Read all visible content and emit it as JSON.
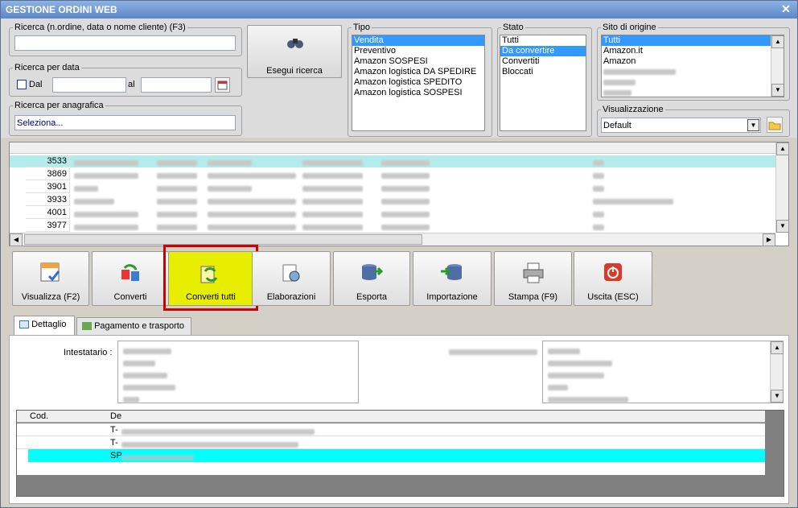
{
  "window": {
    "title": "GESTIONE ORDINI WEB"
  },
  "search": {
    "legend": "Ricerca (n.ordine, data o nome cliente) (F3)",
    "value": ""
  },
  "search_date": {
    "legend": "Ricerca per data",
    "dal_label": "Dal",
    "al_label": "al"
  },
  "search_registry": {
    "legend": "Ricerca per anagrafica",
    "value": "Seleziona..."
  },
  "run_search_button": {
    "label": "Esegui ricerca"
  },
  "tipo": {
    "legend": "Tipo",
    "items": [
      "Vendita",
      "Preventivo",
      "Amazon SOSPESI",
      "Amazon logistica DA SPEDIRE",
      "Amazon logistica SPEDITO",
      "Amazon logistica SOSPESI"
    ],
    "selected_index": 0
  },
  "stato": {
    "legend": "Stato",
    "items": [
      "Tutti",
      "Da convertire",
      "Convertiti",
      "Bloccati"
    ],
    "selected_index": 1
  },
  "sito": {
    "legend": "Sito di origine",
    "items": [
      "Tutti",
      "Amazon.it",
      "Amazon"
    ],
    "selected_index": 0
  },
  "visualizzazione": {
    "legend": "Visualizzazione",
    "value": "Default"
  },
  "orders": {
    "ids": [
      "3533",
      "3869",
      "3901",
      "3933",
      "4001",
      "3977"
    ],
    "selected_index": 0
  },
  "toolbar": {
    "buttons": [
      {
        "label": "Visualizza (F2)",
        "icon": "view-icon"
      },
      {
        "label": "Converti",
        "icon": "convert-icon"
      },
      {
        "label": "Converti tutti",
        "icon": "convert-all-icon"
      },
      {
        "label": "Elaborazioni",
        "icon": "processing-icon"
      },
      {
        "label": "Esporta",
        "icon": "export-icon"
      },
      {
        "label": "Importazione",
        "icon": "import-icon"
      },
      {
        "label": "Stampa (F9)",
        "icon": "print-icon"
      },
      {
        "label": "Uscita (ESC)",
        "icon": "exit-icon"
      }
    ],
    "highlighted_index": 2
  },
  "tabs": [
    {
      "label": "Dettaglio",
      "icon": "detail-icon"
    },
    {
      "label": "Pagamento e trasporto",
      "icon": "payment-icon"
    }
  ],
  "detail": {
    "holder_label": "Intestatario :",
    "lines_header": {
      "code": "Cod.",
      "description": "De"
    },
    "lines": [
      {
        "description_prefix": "T-"
      },
      {
        "description_prefix": "T-"
      },
      {
        "description_prefix": "SP"
      }
    ]
  },
  "colors": {
    "accent_selection": "#3399ff",
    "row_highlight": "#00ffff",
    "focus_frame": "#cc0000",
    "button_highlight": "#e8ee00"
  }
}
